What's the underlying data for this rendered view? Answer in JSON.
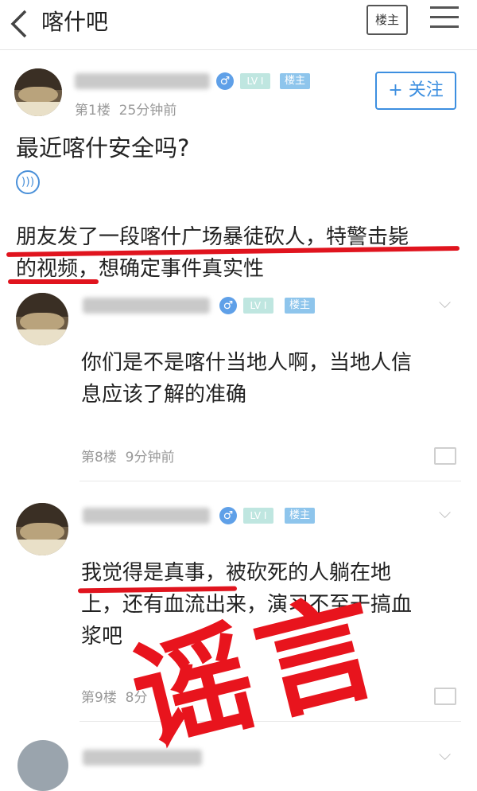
{
  "nav": {
    "title": "喀什吧",
    "owner_label": "楼主"
  },
  "post": {
    "floor_time": "第1楼  25分钟前",
    "follow_label": "+ 关注",
    "lv_label": "LV I",
    "host_label": "楼主",
    "title": "最近喀什安全吗?",
    "body_line1": "朋友发了一段喀什广场暴徒砍人，特警击毙",
    "body_line2": "的视频，想确定事件真实性"
  },
  "comments": [
    {
      "lv_label": "LV I",
      "host_label": "楼主",
      "text_line1": "你们是不是喀什当地人啊，当地人信",
      "text_line2": "息应该了解的准确",
      "meta": "第8楼  9分钟前"
    },
    {
      "lv_label": "LV I",
      "host_label": "楼主",
      "text_line1": "我觉得是真事，被砍死的人躺在地",
      "text_line2": "上，还有血流出来，演习不至于搞血",
      "text_line3": "浆吧",
      "meta": "第9楼  8分"
    }
  ],
  "overlay": {
    "stamp": "谣言"
  },
  "colors": {
    "accent_blue": "#3d8fe0",
    "underline_red": "#e0141e",
    "stamp_red": "#e8141d"
  },
  "icons": [
    "back-arrow-icon",
    "menu-icon",
    "male-icon",
    "audio-icon",
    "chevron-down-icon",
    "comment-icon"
  ]
}
